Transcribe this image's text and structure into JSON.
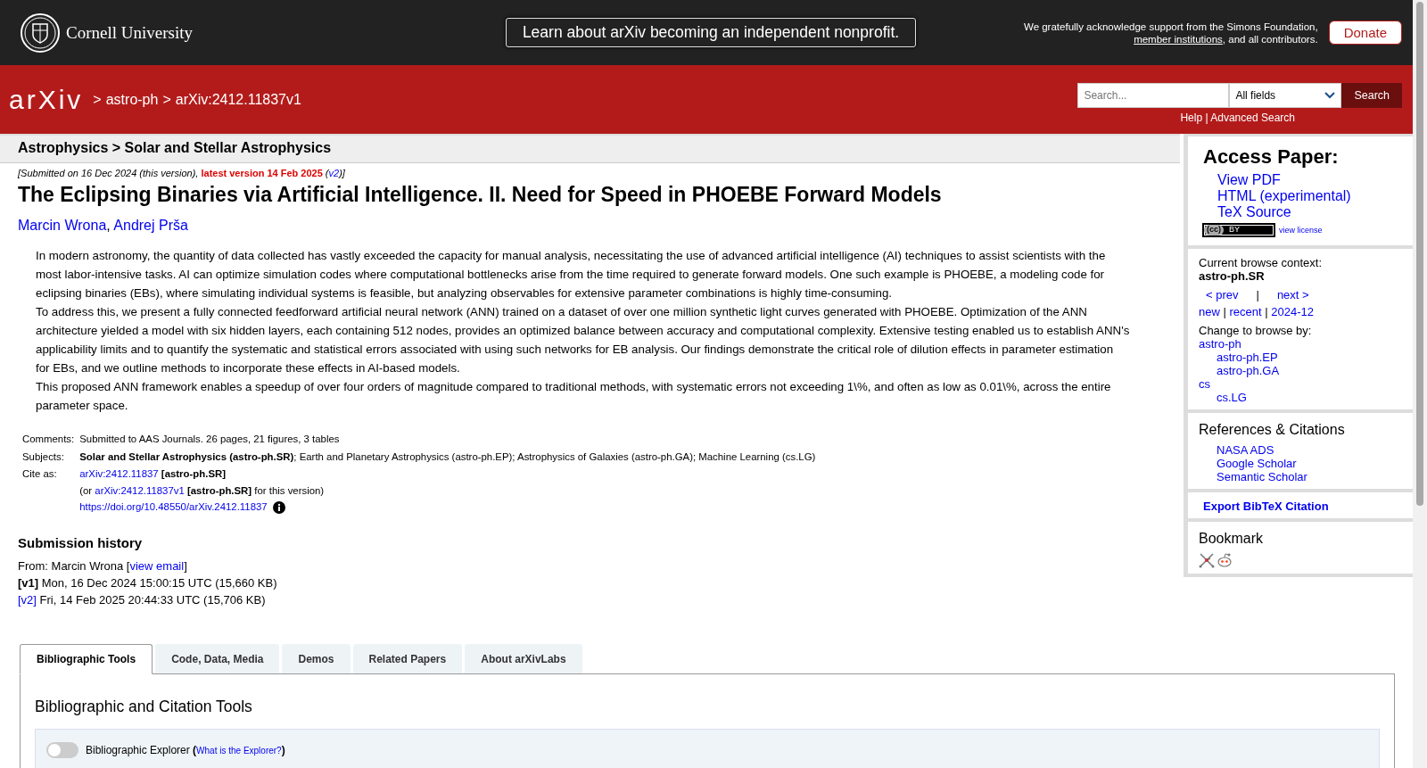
{
  "top_bar": {
    "institution": "Cornell University",
    "announcement": "Learn about arXiv becoming an independent nonprofit.",
    "support": {
      "before": "We gratefully acknowledge support from the Simons Foundation, ",
      "link": "member institutions",
      "after": ", and all contributors."
    },
    "donate": "Donate"
  },
  "header": {
    "logo": "arXiv",
    "breadcrumbs": [
      {
        "sep": ">",
        "label": "astro-ph"
      },
      {
        "sep": ">",
        "label": "arXiv:2412.11837v1"
      }
    ],
    "search": {
      "placeholder": "Search...",
      "field": "All fields",
      "button": "Search",
      "links": [
        {
          "label": "Help"
        },
        {
          "sep": "|",
          "label": "Advanced Search"
        }
      ]
    }
  },
  "subject_bar": "Astrophysics > Solar and Stellar Astrophysics",
  "submitted": {
    "before": "[Submitted on 16 Dec 2024 (this version), ",
    "latest": "latest version 14 Feb 2025",
    "middle": " (",
    "link": "v2",
    "after": ")]"
  },
  "title": "The Eclipsing Binaries via Artificial Intelligence. II. Need for Speed in PHOEBE Forward Models",
  "authors": [
    {
      "name": "Marcin Wrona",
      "trail": ","
    },
    {
      "name": "Andrej Prša"
    }
  ],
  "abstract": [
    "In modern astronomy, the quantity of data collected has vastly exceeded the capacity for manual analysis, necessitating the use of advanced artificial intelligence (AI) techniques to assist scientists with the most labor-intensive tasks. AI can optimize simulation codes where computational bottlenecks arise from the time required to generate forward models. One such example is PHOEBE, a modeling code for eclipsing binaries (EBs), where simulating individual systems is feasible, but analyzing observables for extensive parameter combinations is highly time-consuming.",
    "To address this, we present a fully connected feedforward artificial neural network (ANN) trained on a dataset of over one million synthetic light curves generated with PHOEBE. Optimization of the ANN architecture yielded a model with six hidden layers, each containing 512 nodes, provides an optimized balance between accuracy and computational complexity. Extensive testing enabled us to establish ANN's applicability limits and to quantify the systematic and statistical errors associated with using such networks for EB analysis. Our findings demonstrate the critical role of dilution effects in parameter estimation for EBs, and we outline methods to incorporate these effects in AI-based models.",
    "This proposed ANN framework enables a speedup of over four orders of magnitude compared to traditional methods, with systematic errors not exceeding 1\\%, and often as low as 0.01\\%, across the entire parameter space."
  ],
  "metadata": {
    "comments_label": "Comments:",
    "comments": "Submitted to AAS Journals. 26 pages, 21 figures, 3 tables",
    "subjects_label": "Subjects:",
    "subjects": "**Solar and Stellar Astrophysics (astro-ph.SR)**; Earth and Planetary Astrophysics (astro-ph.EP); Astrophysics of Galaxies (astro-ph.GA); Machine Learning (cs.LG)",
    "cite_label": "Cite as:",
    "cite": [
      {
        "kind": "plain",
        "link": "arXiv:2412.11837",
        "after": " **[astro-ph.SR]**"
      },
      {
        "kind": "plain",
        "before": "(or ",
        "link": "arXiv:2412.11837v1",
        "after": " **[astro-ph.SR]** for this version)"
      },
      {
        "kind": "doi",
        "link": "https://doi.org/10.48550/arXiv.2412.11837"
      }
    ]
  },
  "history": {
    "heading": "Submission history",
    "from": {
      "before": "From: Marcin Wrona [",
      "link": "view email",
      "after": "]"
    },
    "versions": [
      {
        "kind": "current",
        "version": "[v1]",
        "text": " Mon, 16 Dec 2024 15:00:15 UTC (15,660 KB)"
      },
      {
        "kind": "link",
        "version": "[v2]",
        "text": " Fri, 14 Feb 2025 20:44:33 UTC (15,706 KB)"
      }
    ]
  },
  "tabs": [
    {
      "label": "Bibliographic Tools",
      "selected": true
    },
    {
      "label": "Code, Data, Media",
      "selected": false
    },
    {
      "label": "Demos",
      "selected": false
    },
    {
      "label": "Related Papers",
      "selected": false
    },
    {
      "label": "About arXivLabs",
      "selected": false
    }
  ],
  "tab_panel": {
    "heading": "Bibliographic and Citation Tools",
    "toggle": {
      "on": false,
      "label": "Bibliographic Explorer",
      "before": " (",
      "link": "What is the Explorer?",
      "after": ")"
    }
  },
  "sidebar": {
    "access": {
      "heading": "Access Paper:",
      "links": [
        "View PDF",
        "HTML (experimental)",
        "TeX Source"
      ],
      "license": {
        "mark": "(cc)",
        "label": "BY"
      },
      "license_link": "view license"
    },
    "browse": {
      "label": "Current browse context:",
      "context": "astro-ph.SR",
      "prev": "< prev",
      "sep": "|",
      "next": "next >",
      "links": [
        {
          "label": "new"
        },
        {
          "sep": "|",
          "label": "recent"
        },
        {
          "sep": "|",
          "label": "2024-12"
        }
      ],
      "change_label": "Change to browse by:",
      "categories": [
        {
          "label": "astro-ph",
          "children": [
            {
              "label": "astro-ph.EP"
            },
            {
              "label": "astro-ph.GA"
            }
          ]
        },
        {
          "label": "cs",
          "children": [
            {
              "label": "cs.LG"
            }
          ]
        }
      ]
    },
    "references": {
      "heading": "References & Citations",
      "links": [
        "NASA ADS",
        "Google Scholar",
        "Semantic Scholar"
      ]
    },
    "export": "Export BibTeX Citation",
    "bookmark": {
      "heading": "Bookmark"
    }
  }
}
